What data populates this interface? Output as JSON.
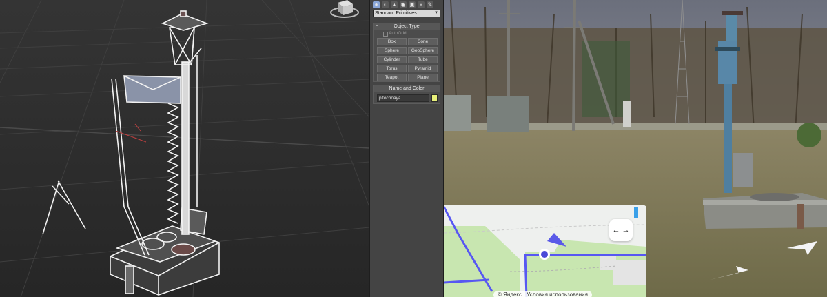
{
  "command_panel": {
    "tabs": [
      "create",
      "modify",
      "hierarchy",
      "motion",
      "display",
      "utilities"
    ],
    "primitive_dropdown": "Standard Primitives",
    "object_type": {
      "title": "Object Type",
      "autogrid_label": "AutoGrid",
      "buttons": [
        "Box",
        "Cone",
        "Sphere",
        "GeoSphere",
        "Cylinder",
        "Tube",
        "Torus",
        "Pyramid",
        "Teapot",
        "Plane"
      ]
    },
    "name_and_color": {
      "title": "Name and Color",
      "object_name": "pitochnaya",
      "swatch_color": "#e8f07a"
    }
  },
  "map": {
    "expand_glyph": "← →",
    "credit": "© Яндекс · Условия использования"
  },
  "colors": {
    "viewport_bg": "#2e2e2e",
    "wire": "#f0f0f0",
    "map_route": "#4a4aff",
    "map_green": "#c8e6b0"
  }
}
